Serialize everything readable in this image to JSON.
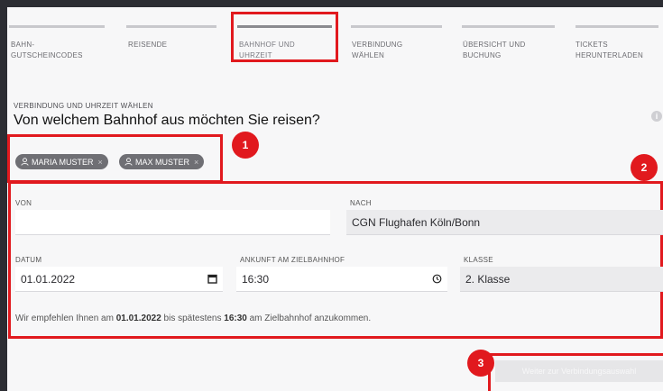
{
  "steps": [
    {
      "label": "BAHN-\nGUTSCHEINCODES"
    },
    {
      "label": "REISENDE"
    },
    {
      "label": "BAHNHOF UND\nUHRZEIT"
    },
    {
      "label": "VERBINDUNG\nWÄHLEN"
    },
    {
      "label": "ÜBERSICHT UND\nBUCHUNG"
    },
    {
      "label": "TICKETS\nHERUNTERLADEN"
    }
  ],
  "section": {
    "caption": "VERBINDUNG UND UHRZEIT WÄHLEN",
    "heading": "Von welchem Bahnhof aus möchten Sie reisen?",
    "info_icon_glyph": "i"
  },
  "travellers": [
    {
      "name": "MARIA MUSTER"
    },
    {
      "name": "MAX MUSTER"
    }
  ],
  "icons": {
    "person": "person-icon",
    "close": "×"
  },
  "form": {
    "von": {
      "label": "VON",
      "value": ""
    },
    "nach": {
      "label": "NACH",
      "value": "CGN Flughafen Köln/Bonn"
    },
    "datum": {
      "label": "DATUM",
      "value": "01.01.2022"
    },
    "ankunft": {
      "label": "ANKUNFT AM ZIELBAHNHOF",
      "value": "16:30"
    },
    "klasse": {
      "label": "KLASSE",
      "value": "2. Klasse"
    }
  },
  "hint": {
    "before": "Wir empfehlen Ihnen am ",
    "date": "01.01.2022",
    "middle": " bis spätestens ",
    "time": "16:30",
    "after": " am Zielbahnhof anzukommen."
  },
  "continue_button": {
    "label": "Weiter zur Verbindungsauswahl"
  },
  "annotations": [
    {
      "number": "1"
    },
    {
      "number": "2"
    },
    {
      "number": "3"
    }
  ],
  "colors": {
    "highlight": "#e1191e",
    "frame": "#2c2d33",
    "panel": "#f7f7f8"
  }
}
